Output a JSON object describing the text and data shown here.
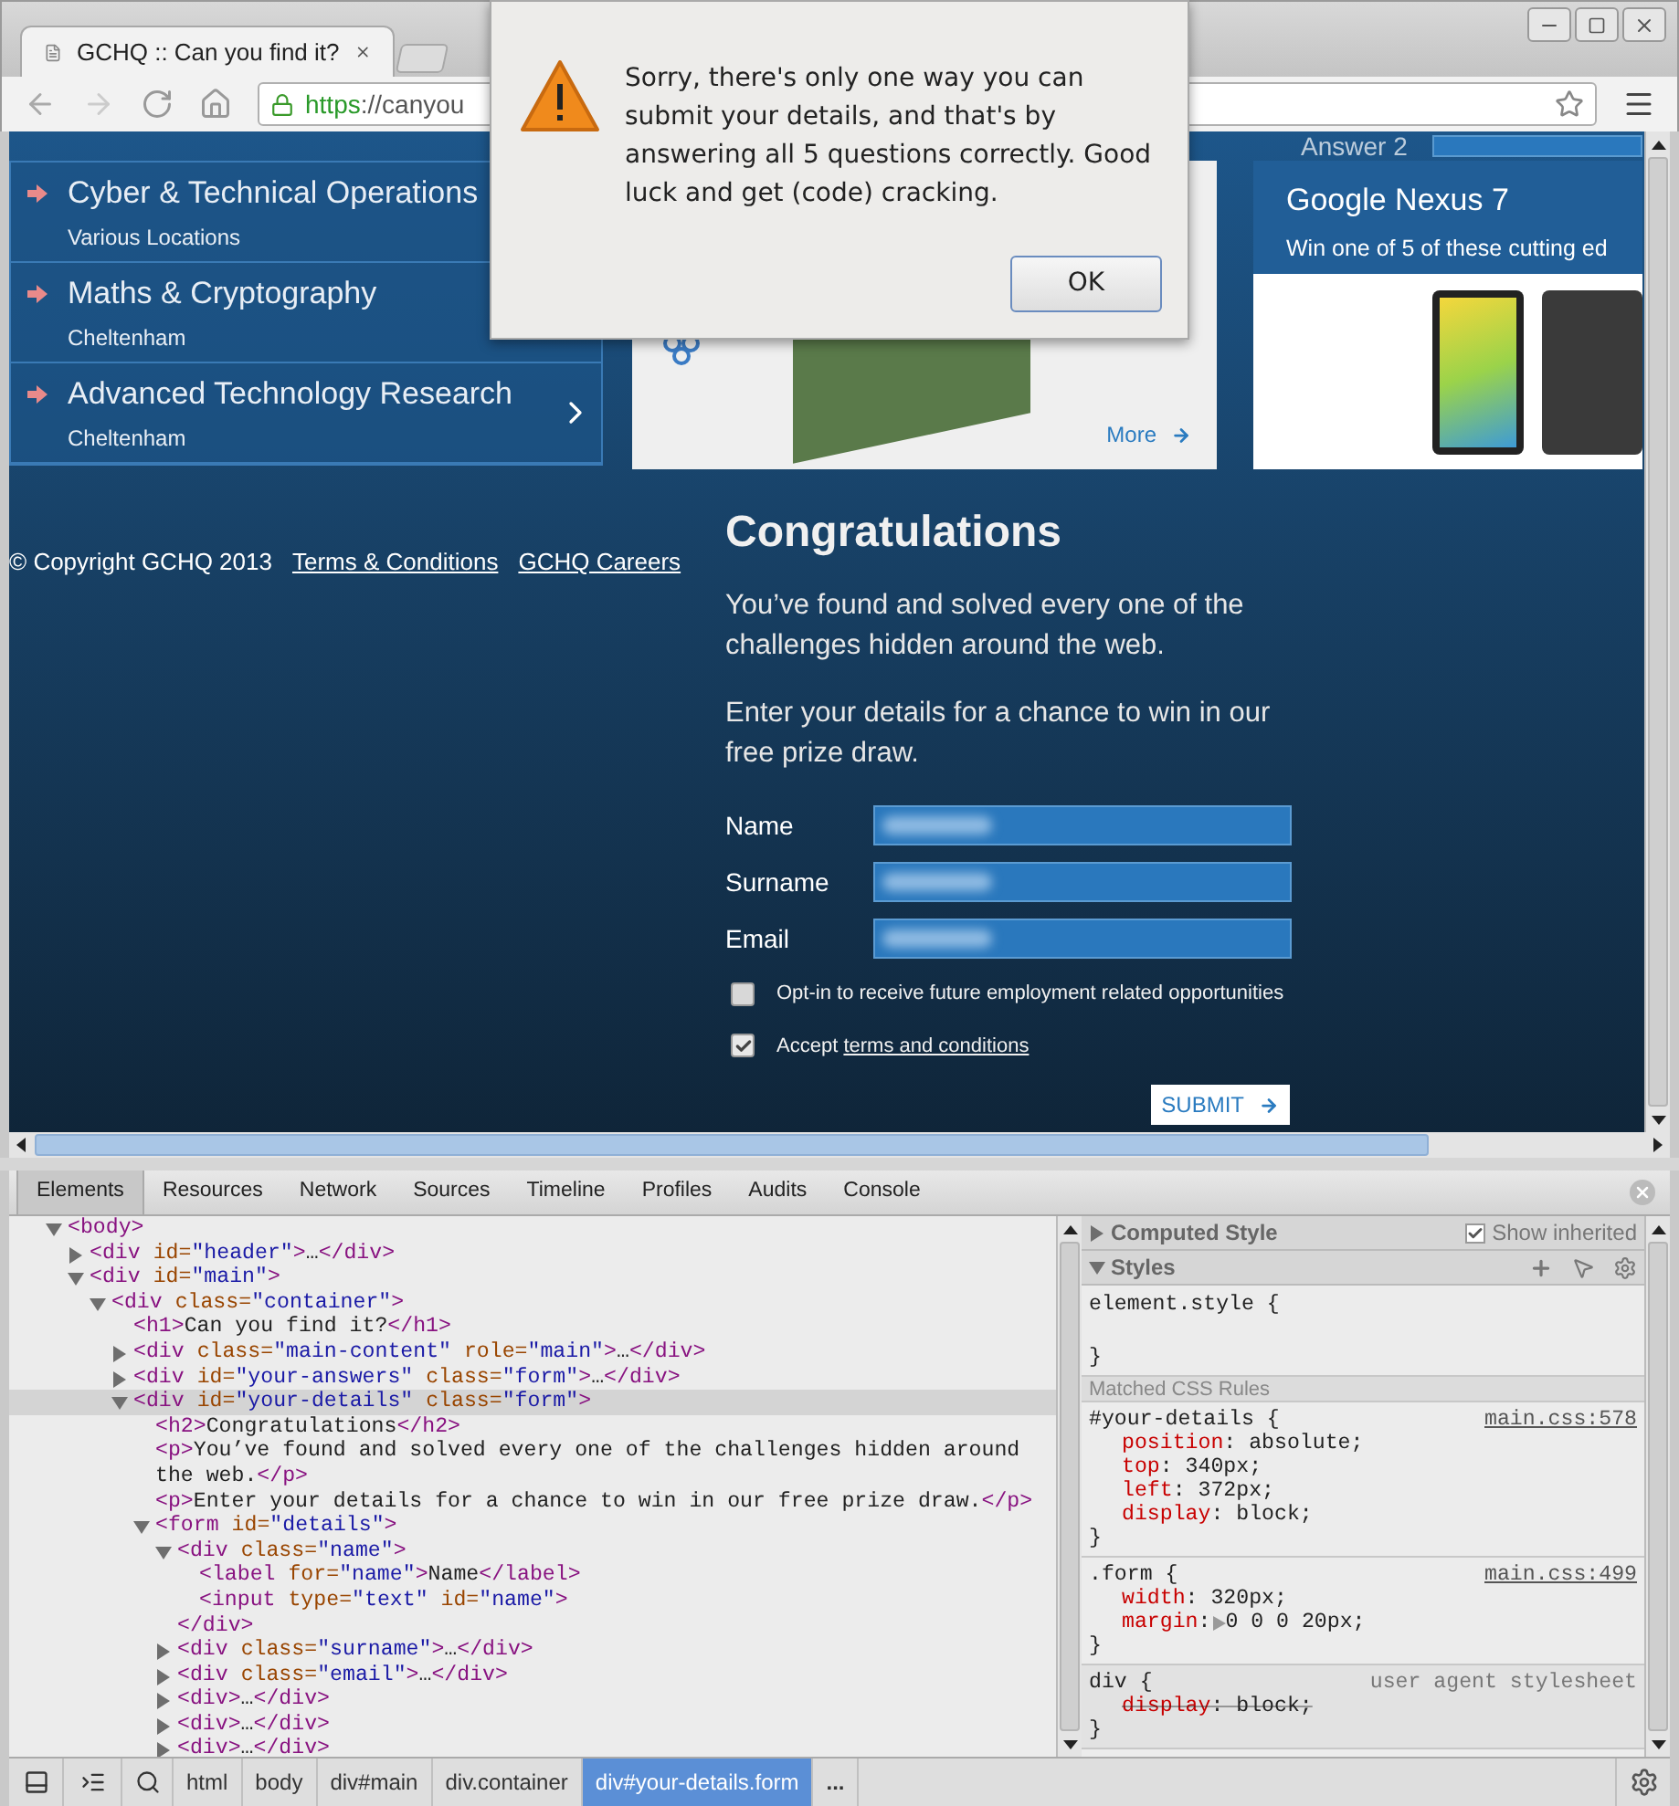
{
  "browser": {
    "tab": {
      "title": "GCHQ :: Can you find it?",
      "selected": true
    },
    "url": {
      "scheme": "https",
      "rest": "://canyou"
    }
  },
  "alert": {
    "message": "Sorry, there's only one way you can submit your details, and that's by answering all 5 questions correctly. Good luck and get (code) cracking.",
    "button": "OK"
  },
  "nav": [
    {
      "title": "Cyber & Technical Operations",
      "location": "Various Locations"
    },
    {
      "title": "Maths & Cryptography",
      "location": "Cheltenham"
    },
    {
      "title": "Advanced Technology Research",
      "location": "Cheltenham"
    }
  ],
  "promo_cards": [
    {
      "kind": "raspberry",
      "link": "More"
    },
    {
      "kind": "nexus",
      "answer_label": "Answer 2",
      "title": "Google Nexus 7",
      "subtitle": "Win one of 5 of these cutting ed"
    }
  ],
  "footer": {
    "copyright": "© Copyright GCHQ 2013",
    "links": [
      "Terms & Conditions",
      "GCHQ Careers"
    ]
  },
  "details": {
    "heading": "Congratulations",
    "paragraphs": [
      "You’ve found and solved every one of the challenges hidden around the web.",
      "Enter your details for a chance to win in our free prize draw."
    ],
    "fields": [
      {
        "label": "Name"
      },
      {
        "label": "Surname"
      },
      {
        "label": "Email"
      }
    ],
    "checkboxes": [
      {
        "label": "Opt-in to receive future employment related opportunities",
        "checked": false
      },
      {
        "label": "Accept",
        "link": "terms and conditions",
        "checked": true
      }
    ],
    "submit": "SUBMIT"
  },
  "devtools": {
    "tabs": [
      {
        "label": "Elements",
        "selected": true
      },
      {
        "label": "Resources",
        "selected": false
      },
      {
        "label": "Network",
        "selected": false
      },
      {
        "label": "Sources",
        "selected": false
      },
      {
        "label": "Timeline",
        "selected": false
      },
      {
        "label": "Profiles",
        "selected": false
      },
      {
        "label": "Audits",
        "selected": false
      },
      {
        "label": "Console",
        "selected": false
      }
    ],
    "dom_tree": [
      {
        "markup": "<body>",
        "kind": "container",
        "expanded": true,
        "selected": false,
        "children": [
          {
            "markup": "<div id=\"header\">…</div>",
            "kind": "container",
            "expanded": false,
            "selected": false
          },
          {
            "markup": "<div id=\"main\">",
            "kind": "container",
            "expanded": true,
            "selected": false,
            "children": [
              {
                "markup": "<div class=\"container\">",
                "kind": "container",
                "expanded": true,
                "selected": false,
                "children": [
                  {
                    "markup": "<h1>Can you find it?</h1>",
                    "kind": "leaf",
                    "selected": false
                  },
                  {
                    "markup": "<div class=\"main-content\" role=\"main\">…</div>",
                    "kind": "container",
                    "expanded": false,
                    "selected": false
                  },
                  {
                    "markup": "<div id=\"your-answers\" class=\"form\">…</div>",
                    "kind": "container",
                    "expanded": false,
                    "selected": false
                  },
                  {
                    "markup": "<div id=\"your-details\" class=\"form\">",
                    "kind": "container",
                    "expanded": true,
                    "selected": true,
                    "children": [
                      {
                        "markup": "<h2>Congratulations</h2>",
                        "kind": "leaf",
                        "selected": false
                      },
                      {
                        "markup": "<p>You’ve found and solved every one of the challenges hidden around the web.</p>",
                        "kind": "leaf",
                        "selected": false
                      },
                      {
                        "markup": "<p>Enter your details for a chance to win in our free prize draw.</p>",
                        "kind": "leaf",
                        "selected": false
                      },
                      {
                        "markup": "<form id=\"details\">",
                        "kind": "container",
                        "expanded": true,
                        "selected": false,
                        "children": [
                          {
                            "markup": "<div class=\"name\">",
                            "kind": "container",
                            "expanded": true,
                            "selected": false,
                            "children": [
                              {
                                "markup": "<label for=\"name\">Name</label>",
                                "kind": "leaf",
                                "selected": false
                              },
                              {
                                "markup": "<input type=\"text\" id=\"name\">",
                                "kind": "leaf",
                                "selected": false
                              }
                            ]
                          },
                          {
                            "markup": "</div>",
                            "kind": "leaf",
                            "selected": false
                          },
                          {
                            "markup": "<div class=\"surname\">…</div>",
                            "kind": "container",
                            "expanded": false,
                            "selected": false
                          },
                          {
                            "markup": "<div class=\"email\">…</div>",
                            "kind": "container",
                            "expanded": false,
                            "selected": false
                          },
                          {
                            "markup": "<div>…</div>",
                            "kind": "container",
                            "expanded": false,
                            "selected": false
                          },
                          {
                            "markup": "<div>…</div>",
                            "kind": "container",
                            "expanded": false,
                            "selected": false
                          },
                          {
                            "markup": "<div>…</div>",
                            "kind": "container",
                            "expanded": false,
                            "selected": false
                          }
                        ]
                      }
                    ]
                  }
                ]
              }
            ]
          }
        ]
      }
    ],
    "styles": {
      "computed": {
        "title": "Computed Style",
        "expanded": false,
        "show_inherited": {
          "label": "Show inherited",
          "checked": true
        }
      },
      "styles_header": {
        "title": "Styles",
        "expanded": true
      },
      "element_style": {
        "open": "element.style {",
        "close": "}"
      },
      "matched_label": "Matched CSS Rules",
      "rules": [
        {
          "selector": "#your-details {",
          "source": "main.css:578",
          "is_link": true,
          "close": "}",
          "properties": [
            {
              "name": "position",
              "sep": ": ",
              "value": "absolute;",
              "overridden": false,
              "expandable": false
            },
            {
              "name": "top",
              "sep": ": ",
              "value": "340px;",
              "overridden": false,
              "expandable": false
            },
            {
              "name": "left",
              "sep": ": ",
              "value": "372px;",
              "overridden": false,
              "expandable": false
            },
            {
              "name": "display",
              "sep": ": ",
              "value": "block;",
              "overridden": false,
              "expandable": false
            }
          ]
        },
        {
          "selector": ".form {",
          "source": "main.css:499",
          "is_link": true,
          "close": "}",
          "properties": [
            {
              "name": "width",
              "sep": ": ",
              "value": "320px;",
              "overridden": false,
              "expandable": false
            },
            {
              "name": "margin",
              "sep": ":",
              "value": "0 0 0 20px;",
              "overridden": false,
              "expandable": true
            }
          ]
        },
        {
          "selector": "div {",
          "source": "user agent stylesheet",
          "is_link": false,
          "close": "}",
          "properties": [
            {
              "name": "display",
              "sep": ": ",
              "value": "block;",
              "overridden": true,
              "expandable": false
            }
          ]
        }
      ]
    },
    "breadcrumbs": [
      {
        "label": "html",
        "selected": false
      },
      {
        "label": "body",
        "selected": false
      },
      {
        "label": "div#main",
        "selected": false
      },
      {
        "label": "div.container",
        "selected": false
      },
      {
        "label": "div#your-details.form",
        "selected": true
      }
    ],
    "more": "..."
  }
}
